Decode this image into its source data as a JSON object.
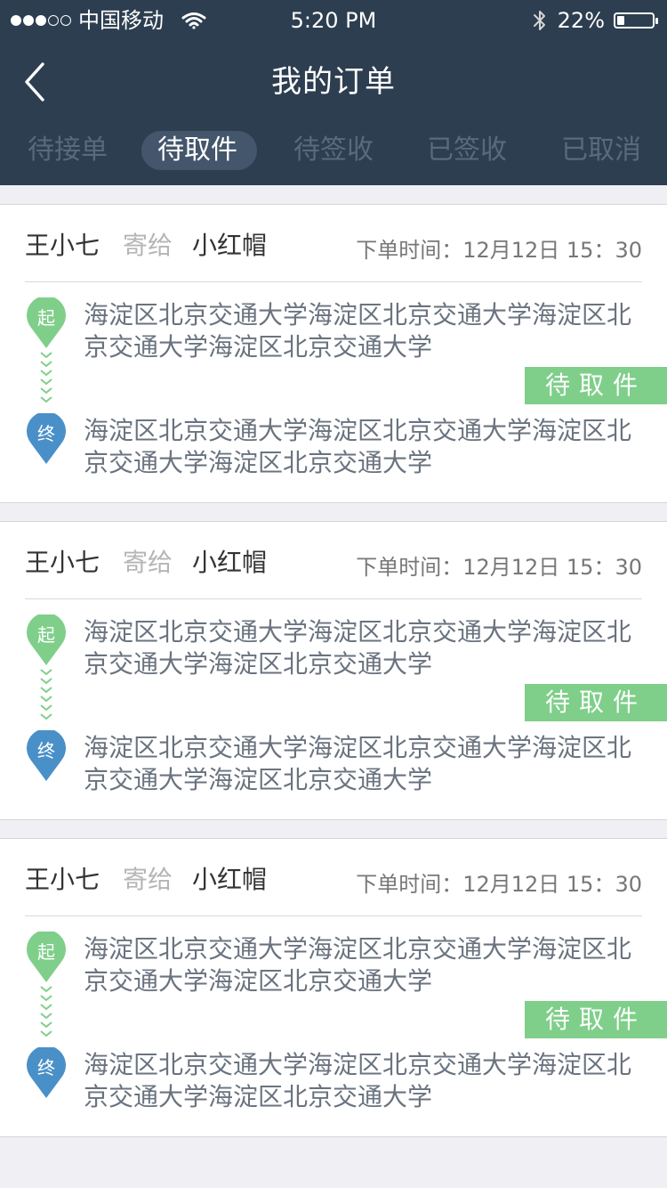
{
  "status_bar": {
    "carrier": "中国移动",
    "time": "5:20 PM",
    "battery": "22%"
  },
  "nav": {
    "title": "我的订单"
  },
  "tabs": [
    {
      "label": "待接单",
      "active": false
    },
    {
      "label": "待取件",
      "active": true
    },
    {
      "label": "待签收",
      "active": false
    },
    {
      "label": "已签收",
      "active": false
    },
    {
      "label": "已取消",
      "active": false
    }
  ],
  "orders": [
    {
      "sender": "王小七",
      "send_to": "寄给",
      "receiver": "小红帽",
      "order_time": "下单时间：12月12日 15：30",
      "start_marker": "起",
      "end_marker": "终",
      "start_address": "海淀区北京交通大学海淀区北京交通大学海淀区北京交通大学海淀区北京交通大学",
      "end_address": "海淀区北京交通大学海淀区北京交通大学海淀区北京交通大学海淀区北京交通大学",
      "status": "待取件"
    },
    {
      "sender": "王小七",
      "send_to": "寄给",
      "receiver": "小红帽",
      "order_time": "下单时间：12月12日 15：30",
      "start_marker": "起",
      "end_marker": "终",
      "start_address": "海淀区北京交通大学海淀区北京交通大学海淀区北京交通大学海淀区北京交通大学",
      "end_address": "海淀区北京交通大学海淀区北京交通大学海淀区北京交通大学海淀区北京交通大学",
      "status": "待取件"
    },
    {
      "sender": "王小七",
      "send_to": "寄给",
      "receiver": "小红帽",
      "order_time": "下单时间：12月12日 15：30",
      "start_marker": "起",
      "end_marker": "终",
      "start_address": "海淀区北京交通大学海淀区北京交通大学海淀区北京交通大学海淀区北京交通大学",
      "end_address": "海淀区北京交通大学海淀区北京交通大学海淀区北京交通大学海淀区北京交通大学",
      "status": "待取件"
    }
  ],
  "colors": {
    "header_bg": "#2d3e50",
    "active_tab_bg": "#44566b",
    "start_pin": "#7fcf8a",
    "end_pin": "#4a90c8",
    "status_tag": "#7fcf8a"
  },
  "icons": {
    "back": "chevron-left-icon",
    "wifi": "wifi-icon",
    "bluetooth": "bluetooth-icon",
    "battery": "battery-icon"
  }
}
